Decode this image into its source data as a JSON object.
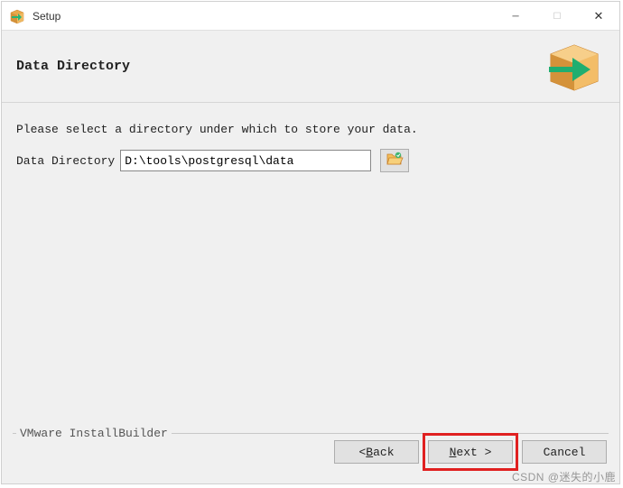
{
  "titlebar": {
    "title": "Setup"
  },
  "header": {
    "page_title": "Data Directory"
  },
  "content": {
    "instruction": "Please select a directory under which to store your data.",
    "field_label": "Data Directory",
    "field_value": "D:\\tools\\postgresql\\data"
  },
  "footer": {
    "vendor": "VMware InstallBuilder",
    "back_prefix": "< ",
    "back_key": "B",
    "back_rest": "ack",
    "next_key": "N",
    "next_rest": "ext >",
    "cancel_label": "Cancel"
  },
  "watermark": "CSDN @迷失的小鹿"
}
